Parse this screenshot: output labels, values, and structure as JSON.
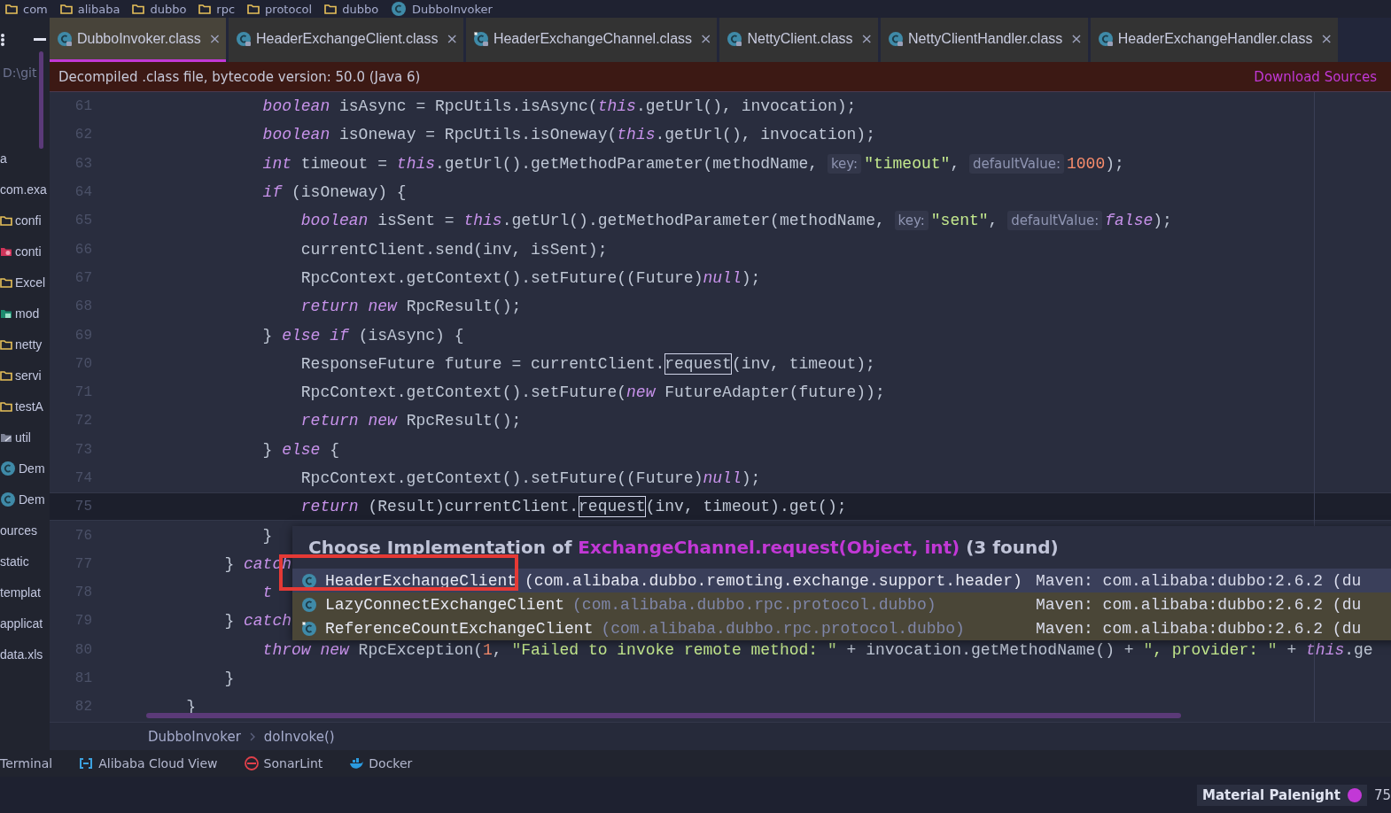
{
  "path_bar": {
    "items": [
      {
        "kind": "folder",
        "label": "com"
      },
      {
        "kind": "folder",
        "label": "alibaba"
      },
      {
        "kind": "folder",
        "label": "dubbo"
      },
      {
        "kind": "folder",
        "label": "rpc"
      },
      {
        "kind": "folder",
        "label": "protocol"
      },
      {
        "kind": "folder",
        "label": "dubbo"
      },
      {
        "kind": "class",
        "label": "DubboInvoker"
      }
    ]
  },
  "project_panel": {
    "path": "D:\\git",
    "items": [
      {
        "kind": "none",
        "label": "a"
      },
      {
        "kind": "none",
        "label": "com.exa"
      },
      {
        "kind": "folder",
        "label": "confi"
      },
      {
        "kind": "gear-folder",
        "label": "conti"
      },
      {
        "kind": "folder",
        "label": "Excel"
      },
      {
        "kind": "model-folder",
        "label": "mod"
      },
      {
        "kind": "folder",
        "label": "netty"
      },
      {
        "kind": "folder",
        "label": "servi"
      },
      {
        "kind": "folder",
        "label": "testA"
      },
      {
        "kind": "tool-folder",
        "label": "util"
      },
      {
        "kind": "class",
        "label": "Dem"
      },
      {
        "kind": "class",
        "label": "Dem"
      },
      {
        "kind": "none",
        "label": "ources"
      },
      {
        "kind": "none",
        "label": "static"
      },
      {
        "kind": "none",
        "label": "templat"
      },
      {
        "kind": "none",
        "label": "applicat"
      },
      {
        "kind": "none",
        "label": "data.xls"
      }
    ]
  },
  "tabs": [
    {
      "kind": "class",
      "label": "DubboInvoker.class",
      "close": "×",
      "selected": true
    },
    {
      "kind": "class",
      "label": "HeaderExchangeClient.class",
      "close": "×",
      "selected": false
    },
    {
      "kind": "interface",
      "label": "HeaderExchangeChannel.class",
      "close": "×",
      "selected": false
    },
    {
      "kind": "class",
      "label": "NettyClient.class",
      "close": "×",
      "selected": false
    },
    {
      "kind": "class",
      "label": "NettyClientHandler.class",
      "close": "×",
      "selected": false
    },
    {
      "kind": "class",
      "label": "HeaderExchangeHandler.class",
      "close": "×",
      "selected": false
    }
  ],
  "notice": {
    "text": "Decompiled .class file, bytecode version: 50.0 (Java 6)",
    "link": "Download Sources"
  },
  "code_lines": [
    {
      "number": "61",
      "current": false,
      "tokens": [
        {
          "kind": "kw",
          "text": "            boolean"
        },
        {
          "kind": "txt",
          "text": " isAsync = RpcUtils.isAsync("
        },
        {
          "kind": "kw",
          "text": "this"
        },
        {
          "kind": "txt",
          "text": ".getUrl(), invocation);"
        }
      ]
    },
    {
      "number": "62",
      "current": false,
      "tokens": [
        {
          "kind": "kw",
          "text": "            boolean"
        },
        {
          "kind": "txt",
          "text": " isOneway = RpcUtils.isOneway("
        },
        {
          "kind": "kw",
          "text": "this"
        },
        {
          "kind": "txt",
          "text": ".getUrl(), invocation);"
        }
      ]
    },
    {
      "number": "63",
      "current": false,
      "tokens": [
        {
          "kind": "kw",
          "text": "            int"
        },
        {
          "kind": "txt",
          "text": " timeout = "
        },
        {
          "kind": "kw",
          "text": "this"
        },
        {
          "kind": "txt",
          "text": ".getUrl().getMethodParameter(methodName, "
        },
        {
          "kind": "hint",
          "text": "key:"
        },
        {
          "kind": "str",
          "text": "\"timeout\""
        },
        {
          "kind": "txt",
          "text": ", "
        },
        {
          "kind": "hint",
          "text": "defaultValue:"
        },
        {
          "kind": "num",
          "text": "1000"
        },
        {
          "kind": "txt",
          "text": ");"
        }
      ]
    },
    {
      "number": "64",
      "current": false,
      "tokens": [
        {
          "kind": "kw",
          "text": "            if"
        },
        {
          "kind": "txt",
          "text": " (isOneway) {"
        }
      ]
    },
    {
      "number": "65",
      "current": false,
      "tokens": [
        {
          "kind": "kw",
          "text": "                boolean"
        },
        {
          "kind": "txt",
          "text": " isSent = "
        },
        {
          "kind": "kw",
          "text": "this"
        },
        {
          "kind": "txt",
          "text": ".getUrl().getMethodParameter(methodName, "
        },
        {
          "kind": "hint",
          "text": "key:"
        },
        {
          "kind": "str",
          "text": "\"sent\""
        },
        {
          "kind": "txt",
          "text": ", "
        },
        {
          "kind": "hint",
          "text": "defaultValue:"
        },
        {
          "kind": "kw",
          "text": "false"
        },
        {
          "kind": "txt",
          "text": ");"
        }
      ]
    },
    {
      "number": "66",
      "current": false,
      "tokens": [
        {
          "kind": "txt",
          "text": "                currentClient.send(inv, isSent);"
        }
      ]
    },
    {
      "number": "67",
      "current": false,
      "tokens": [
        {
          "kind": "txt",
          "text": "                RpcContext.getContext().setFuture((Future)"
        },
        {
          "kind": "kw",
          "text": "null"
        },
        {
          "kind": "txt",
          "text": ");"
        }
      ]
    },
    {
      "number": "68",
      "current": false,
      "tokens": [
        {
          "kind": "kw",
          "text": "                return new"
        },
        {
          "kind": "txt",
          "text": " RpcResult();"
        }
      ]
    },
    {
      "number": "69",
      "current": false,
      "tokens": [
        {
          "kind": "txt",
          "text": "            } "
        },
        {
          "kind": "kw",
          "text": "else if"
        },
        {
          "kind": "txt",
          "text": " (isAsync) {"
        }
      ]
    },
    {
      "number": "70",
      "current": false,
      "tokens": [
        {
          "kind": "txt",
          "text": "                ResponseFuture future = currentClient."
        },
        {
          "kind": "usage",
          "text": "request"
        },
        {
          "kind": "txt",
          "text": "(inv, timeout);"
        }
      ]
    },
    {
      "number": "71",
      "current": false,
      "tokens": [
        {
          "kind": "txt",
          "text": "                RpcContext.getContext().setFuture("
        },
        {
          "kind": "kw",
          "text": "new"
        },
        {
          "kind": "txt",
          "text": " FutureAdapter(future));"
        }
      ]
    },
    {
      "number": "72",
      "current": false,
      "tokens": [
        {
          "kind": "kw",
          "text": "                return new"
        },
        {
          "kind": "txt",
          "text": " RpcResult();"
        }
      ]
    },
    {
      "number": "73",
      "current": false,
      "tokens": [
        {
          "kind": "txt",
          "text": "            } "
        },
        {
          "kind": "kw",
          "text": "else"
        },
        {
          "kind": "txt",
          "text": " {"
        }
      ]
    },
    {
      "number": "74",
      "current": false,
      "tokens": [
        {
          "kind": "txt",
          "text": "                RpcContext.getContext().setFuture((Future)"
        },
        {
          "kind": "kw",
          "text": "null"
        },
        {
          "kind": "txt",
          "text": ");"
        }
      ]
    },
    {
      "number": "75",
      "current": true,
      "tokens": [
        {
          "kind": "kw",
          "text": "                return"
        },
        {
          "kind": "txt",
          "text": " (Result)currentClient."
        },
        {
          "kind": "usage",
          "text": "request"
        },
        {
          "kind": "txt",
          "text": "(inv, timeout).get();"
        }
      ]
    },
    {
      "number": "76",
      "current": false,
      "tokens": [
        {
          "kind": "txt",
          "text": "            }"
        }
      ]
    },
    {
      "number": "77",
      "current": false,
      "tokens": [
        {
          "kind": "txt",
          "text": "        } "
        },
        {
          "kind": "kw",
          "text": "catch"
        }
      ]
    },
    {
      "number": "78",
      "current": false,
      "tokens": [
        {
          "kind": "kw",
          "text": "            t"
        }
      ]
    },
    {
      "number": "79",
      "current": false,
      "tokens": [
        {
          "kind": "txt",
          "text": "        } "
        },
        {
          "kind": "kw",
          "text": "catch"
        }
      ]
    },
    {
      "number": "80",
      "current": false,
      "tokens": [
        {
          "kind": "kw",
          "text": "            throw new"
        },
        {
          "kind": "txt",
          "text": " RpcException("
        },
        {
          "kind": "num",
          "text": "1"
        },
        {
          "kind": "txt",
          "text": ", "
        },
        {
          "kind": "str",
          "text": "\"Failed to invoke remote method: \""
        },
        {
          "kind": "txt",
          "text": " + invocation.getMethodName() + "
        },
        {
          "kind": "str",
          "text": "\", provider: \""
        },
        {
          "kind": "txt",
          "text": " + "
        },
        {
          "kind": "kw",
          "text": "this"
        },
        {
          "kind": "txt",
          "text": ".ge"
        }
      ]
    },
    {
      "number": "81",
      "current": false,
      "tokens": [
        {
          "kind": "txt",
          "text": "        }"
        }
      ]
    },
    {
      "number": "82",
      "current": false,
      "tokens": [
        {
          "kind": "txt",
          "text": "    }"
        }
      ]
    }
  ],
  "popup": {
    "title": "Choose Implementation of",
    "method": "ExchangeChannel.request(Object, int)",
    "count": "(3 found)",
    "items": [
      {
        "kind": "class",
        "name": "HeaderExchangeClient",
        "package": "(com.alibaba.dubbo.remoting.exchange.support.header)",
        "source": "Maven: com.alibaba:dubbo:2.6.2 (du",
        "selected": true
      },
      {
        "kind": "class",
        "name": "LazyConnectExchangeClient",
        "package": "(com.alibaba.dubbo.rpc.protocol.dubbo)",
        "source": "Maven: com.alibaba:dubbo:2.6.2 (du",
        "selected": false
      },
      {
        "kind": "interface",
        "name": "ReferenceCountExchangeClient",
        "package": "(com.alibaba.dubbo.rpc.protocol.dubbo)",
        "source": "Maven: com.alibaba:dubbo:2.6.2 (du",
        "selected": false
      }
    ]
  },
  "editor_breadcrumbs": [
    "DubboInvoker",
    "doInvoke()"
  ],
  "tool_windows": [
    {
      "kind": "none",
      "label": "Terminal"
    },
    {
      "kind": "cloud",
      "label": "Alibaba Cloud View"
    },
    {
      "kind": "sonar",
      "label": "SonarLint"
    },
    {
      "kind": "docker",
      "label": "Docker"
    }
  ],
  "status_bar": {
    "theme": "Material Palenight",
    "extra": "75"
  }
}
